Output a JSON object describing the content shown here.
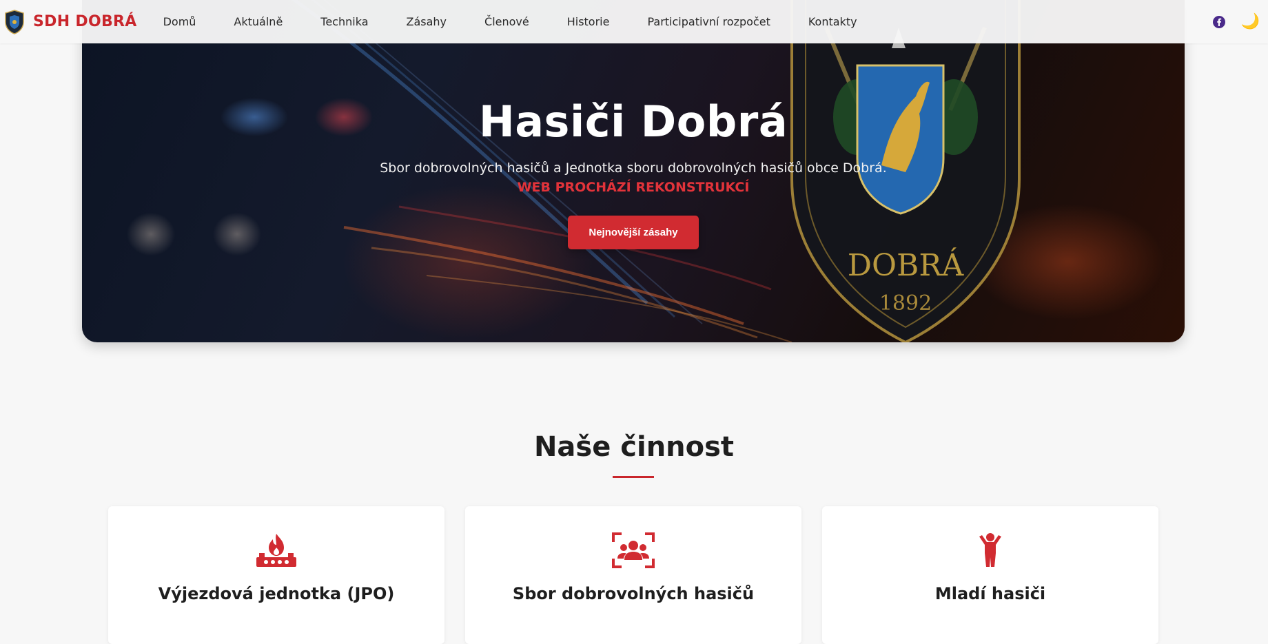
{
  "brand": {
    "name": "SDH DOBRÁ"
  },
  "nav": {
    "items": [
      {
        "label": "Domů"
      },
      {
        "label": "Aktuálně"
      },
      {
        "label": "Technika"
      },
      {
        "label": "Zásahy"
      },
      {
        "label": "Členové"
      },
      {
        "label": "Historie"
      },
      {
        "label": "Participativní rozpočet"
      },
      {
        "label": "Kontakty"
      }
    ],
    "icons": {
      "social": "facebook-icon",
      "theme": "moon-icon"
    }
  },
  "hero": {
    "title": "Hasiči Dobrá",
    "subtitle": "Sbor dobrovolných hasičů a Jednotka sboru dobrovolných hasičů obce Dobrá.",
    "notice": "WEB PROCHÁZÍ REKONSTRUKCÍ",
    "button_label": "Nejnovější zásahy",
    "crest_text": "DOBRÁ",
    "crest_year": "1892"
  },
  "section": {
    "title": "Naše činnost",
    "cards": [
      {
        "title": "Výjezdová jednotka (JPO)",
        "icon": "fire-unit-icon"
      },
      {
        "title": "Sbor dobrovolných hasičů",
        "icon": "group-icon"
      },
      {
        "title": "Mladí hasiči",
        "icon": "child-icon"
      }
    ]
  },
  "colors": {
    "accent": "#c9262c",
    "button": "#d12b31",
    "moon": "#f0b23a",
    "facebook": "#4a2a8a"
  }
}
